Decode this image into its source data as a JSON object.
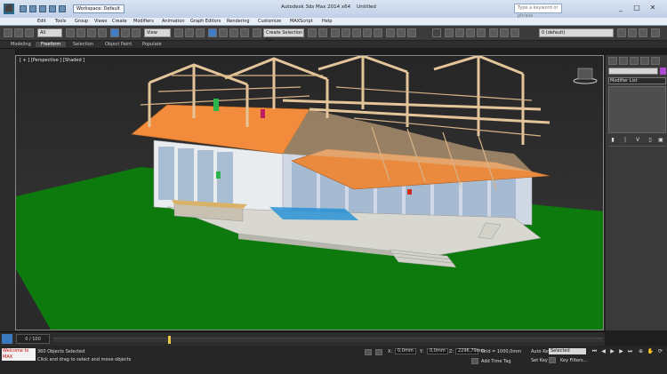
{
  "window": {
    "app_icon": "3ds-max-logo-icon",
    "workspace": "Workspace: Default",
    "title": "Autodesk 3ds Max 2014 x64",
    "document": "Untitled",
    "search_placeholder": "Type a keyword or phrase"
  },
  "menu": [
    "Edit",
    "Tools",
    "Group",
    "Views",
    "Create",
    "Modifiers",
    "Animation",
    "Graph Editors",
    "Rendering",
    "Customize",
    "MAXScript",
    "Help"
  ],
  "toolbar": {
    "undo_selector": "All",
    "view_selector": "View",
    "selection_set": "Create Selection Set",
    "layer": "0 (default)"
  },
  "ribbon": {
    "tabs": [
      "Modeling",
      "Freeform",
      "Selection",
      "Object Paint",
      "Populate"
    ],
    "active": "Freeform"
  },
  "viewport": {
    "label": "[ + ] [Perspective ] [Shaded ]",
    "ground_color": "#0d7a0d",
    "sky_color": "#2e2e2e"
  },
  "command_panel": {
    "modifier_list": "Modifier List",
    "swatch_color": "#b04ad1"
  },
  "timeline": {
    "frame_counter": "0 / 100"
  },
  "status": {
    "maxscript_prompt": "Welcome to MAX",
    "selection": "360 Objects Selected",
    "prompt": "Click and drag to select and move objects",
    "x_label": "X:",
    "x_value": "0,0mm",
    "y_label": "Y:",
    "y_value": "0,0mm",
    "z_label": "Z:",
    "z_value": "2296,79mm",
    "grid": "Grid = 1000,0mm",
    "add_time_tag": "Add Time Tag",
    "auto_key": "Auto Key",
    "set_key": "Set Key",
    "selected": "Selected",
    "key_filters": "Key Filters..."
  }
}
